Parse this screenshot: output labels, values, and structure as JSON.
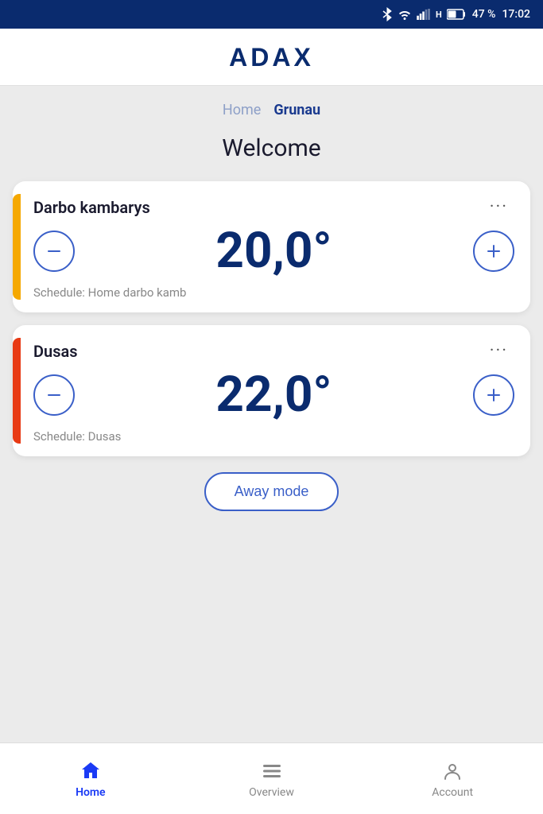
{
  "statusBar": {
    "battery": "47 %",
    "time": "17:02"
  },
  "header": {
    "logo": "ADAX"
  },
  "breadcrumb": {
    "inactive": "Home",
    "active": "Grunau"
  },
  "welcome": {
    "title": "Welcome"
  },
  "devices": [
    {
      "name": "Darbo kambarys",
      "temperature": "20,0°",
      "schedule": "Schedule: Home darbo kamb",
      "indicator": "yellow"
    },
    {
      "name": "Dusas",
      "temperature": "22,0°",
      "schedule": "Schedule: Dusas",
      "indicator": "orange"
    }
  ],
  "awayMode": {
    "label": "Away mode"
  },
  "bottomNav": {
    "items": [
      {
        "id": "home",
        "label": "Home",
        "active": true
      },
      {
        "id": "overview",
        "label": "Overview",
        "active": false
      },
      {
        "id": "account",
        "label": "Account",
        "active": false
      }
    ]
  },
  "colors": {
    "brand": "#0a2b6e",
    "accent": "#1a3af5",
    "yellow": "#f5a800",
    "orange": "#e83a14"
  }
}
